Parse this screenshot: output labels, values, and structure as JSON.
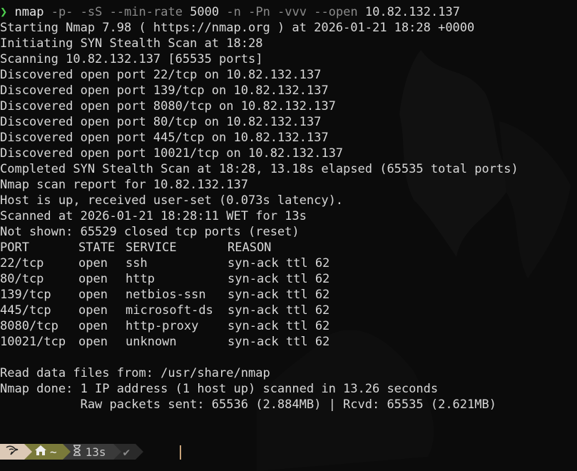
{
  "command": {
    "prompt_symbol": "❯",
    "name": "nmap",
    "flags": "-p- -sS --min-rate",
    "rate": "5000",
    "flags2": "-n -Pn -vvv --open",
    "target": "10.82.132.137"
  },
  "output_lines": [
    "Starting Nmap 7.98 ( https://nmap.org ) at 2026-01-21 18:28 +0000",
    "Initiating SYN Stealth Scan at 18:28",
    "Scanning 10.82.132.137 [65535 ports]",
    "Discovered open port 22/tcp on 10.82.132.137",
    "Discovered open port 139/tcp on 10.82.132.137",
    "Discovered open port 8080/tcp on 10.82.132.137",
    "Discovered open port 80/tcp on 10.82.132.137",
    "Discovered open port 445/tcp on 10.82.132.137",
    "Discovered open port 10021/tcp on 10.82.132.137",
    "Completed SYN Stealth Scan at 18:28, 13.18s elapsed (65535 total ports)",
    "Nmap scan report for 10.82.132.137",
    "Host is up, received user-set (0.073s latency).",
    "Scanned at 2026-01-21 18:28:11 WET for 13s",
    "Not shown: 65529 closed tcp ports (reset)"
  ],
  "table": {
    "headers": [
      "PORT",
      "STATE",
      "SERVICE",
      "REASON"
    ],
    "rows": [
      [
        "22/tcp",
        "open",
        "ssh",
        "syn-ack ttl 62"
      ],
      [
        "80/tcp",
        "open",
        "http",
        "syn-ack ttl 62"
      ],
      [
        "139/tcp",
        "open",
        "netbios-ssn",
        "syn-ack ttl 62"
      ],
      [
        "445/tcp",
        "open",
        "microsoft-ds",
        "syn-ack ttl 62"
      ],
      [
        "8080/tcp",
        "open",
        "http-proxy",
        "syn-ack ttl 62"
      ],
      [
        "10021/tcp",
        "open",
        "unknown",
        "syn-ack ttl 62"
      ]
    ]
  },
  "footer_lines": [
    "Read data files from: /usr/share/nmap",
    "Nmap done: 1 IP address (1 host up) scanned in 13.26 seconds",
    "           Raw packets sent: 65536 (2.884MB) | Rcvd: 65535 (2.621MB)"
  ],
  "status": {
    "os_icon": "kali-dragon-icon",
    "home_icon": "home-icon",
    "home_path": "~",
    "timer_icon": "hourglass-icon",
    "duration": "13s",
    "status_icon": "check-icon",
    "status_symbol": "✔"
  },
  "colors": {
    "prompt": "#4fd14f",
    "seg_os": "#dcc9b6",
    "seg_home": "#7a7a3a",
    "seg_time": "#3a3a3a",
    "seg_status": "#2a2a2a"
  }
}
